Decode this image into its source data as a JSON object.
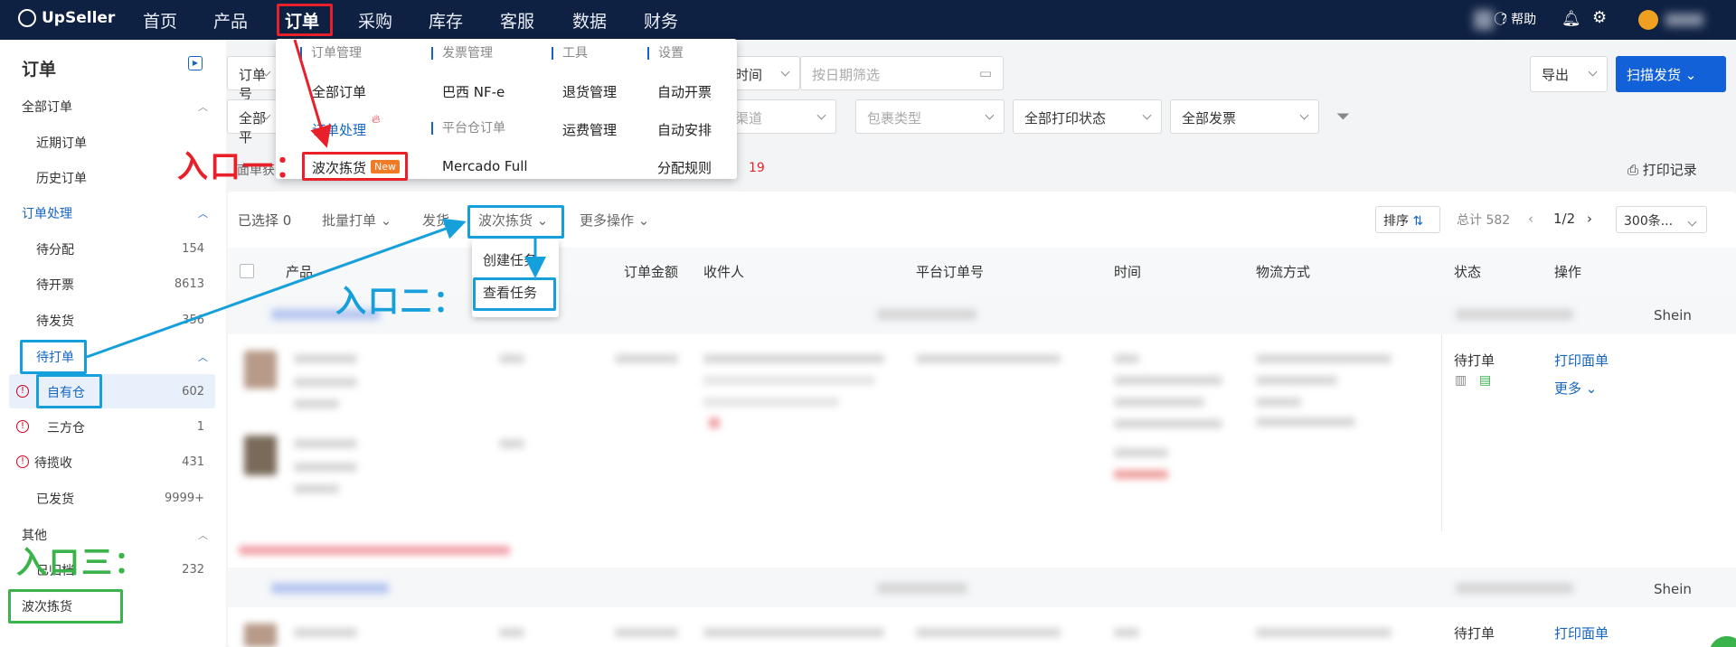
{
  "brand": {
    "name": "UpSeller"
  },
  "nav": {
    "items": [
      "首页",
      "产品",
      "订单",
      "采购",
      "库存",
      "客服",
      "数据",
      "财务"
    ],
    "help": "帮助"
  },
  "sidebar": {
    "title": "订单",
    "all_orders": "全部订单",
    "recent": "近期订单",
    "history": "历史订单",
    "processing": "订单处理",
    "pending_assign": {
      "label": "待分配",
      "count": "154"
    },
    "pending_invoice": {
      "label": "待开票",
      "count": "8613"
    },
    "pending_ship": {
      "label": "待发货",
      "count": "356"
    },
    "pending_print": "待打单",
    "own_wh": {
      "label": "自有仓",
      "count": "602"
    },
    "third_wh": {
      "label": "三方仓",
      "count": "1"
    },
    "pending_pickup": {
      "label": "待揽收",
      "count": "431"
    },
    "shipped": {
      "label": "已发货",
      "count": "9999+"
    },
    "other": "其他",
    "archived": {
      "label": "已归档",
      "count": "232"
    },
    "wave": "波次拣货"
  },
  "filters": {
    "order_no": "订单号",
    "all_platform": "全部平",
    "time": "时间",
    "date_placeholder": "按日期筛选",
    "channel": "渠道",
    "package_type": "包裹类型",
    "print_status": "全部打印状态",
    "invoice": "全部发票"
  },
  "actions": {
    "export": "导出",
    "scan_ship": "扫描发货",
    "print_log": "打印记录"
  },
  "notice": {
    "prefix": "面单获",
    "count": "19"
  },
  "toolbar": {
    "selected": "已选择 0",
    "batch_print": "批量打单",
    "ship": "发货",
    "wave": "波次拣货",
    "more": "更多操作",
    "sort": "排序",
    "total": "总计 582",
    "page": "1/2",
    "per_page": "300条..."
  },
  "wave_menu": {
    "create": "创建任务",
    "view": "查看任务"
  },
  "table": {
    "headers": [
      "产品",
      "订单金额",
      "收件人",
      "平台订单号",
      "时间",
      "物流方式",
      "状态",
      "操作"
    ],
    "shop1": "Shein",
    "shop2": "Shein",
    "row1": {
      "status": "待打单",
      "action": "打印面单",
      "more": "更多"
    },
    "row2": {
      "status": "待打单",
      "action": "打印面单"
    }
  },
  "order_menu": {
    "h1": "订单管理",
    "h2": "发票管理",
    "h3": "工具",
    "h4": "设置",
    "all_orders": "全部订单",
    "nfe": "巴西 NF-e",
    "returns": "退货管理",
    "auto_invoice": "自动开票",
    "processing": "订单处理",
    "platform_wh": "平台仓订单",
    "freight": "运费管理",
    "auto_arrange": "自动安排",
    "wave": "波次拣货",
    "new_badge": "New",
    "mercado": "Mercado Full",
    "rules": "分配规则"
  },
  "annotations": {
    "entry1": "入口一：",
    "entry2": "入口二：",
    "entry3": "入口三："
  }
}
